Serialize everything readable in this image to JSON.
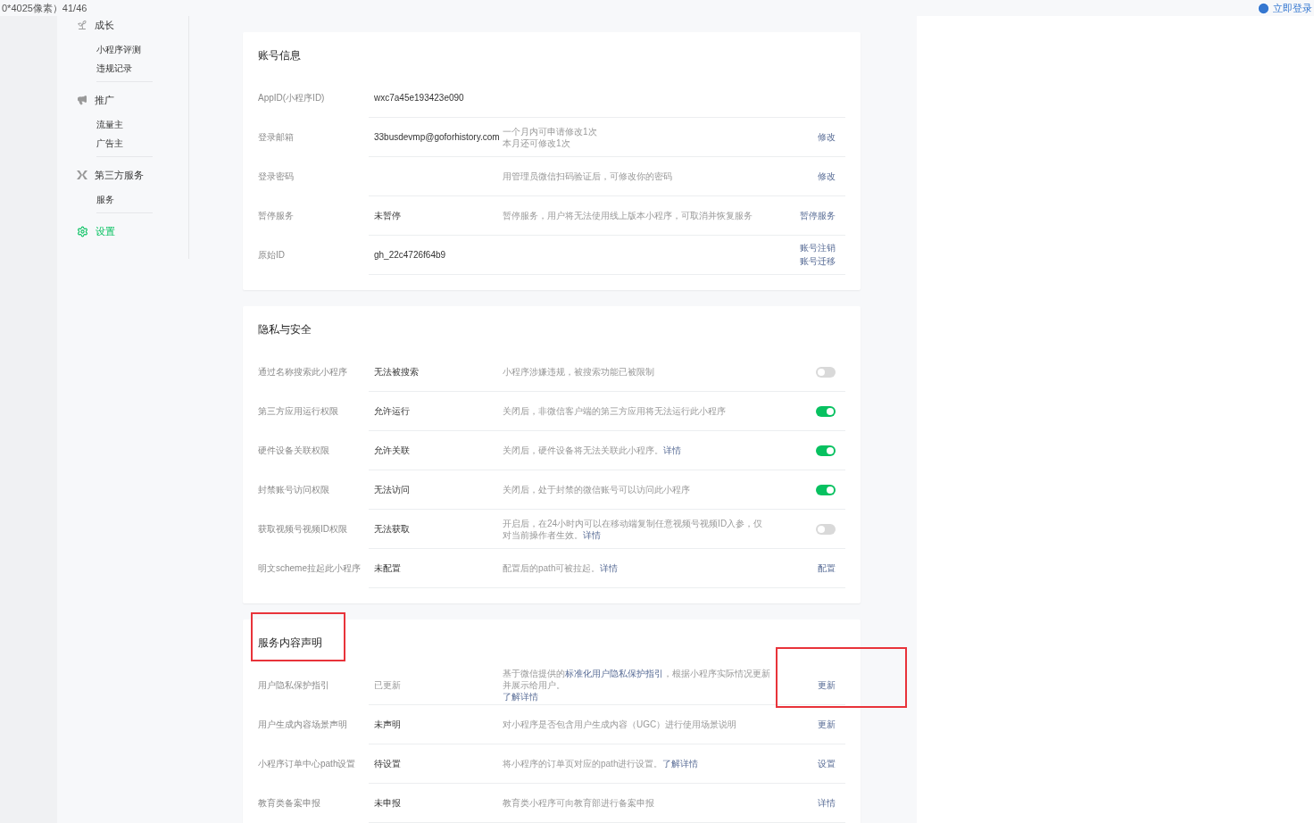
{
  "top_bar": {
    "caption": "0*4025像素）41/46",
    "login": "立即登录"
  },
  "sidebar": {
    "groups": [
      {
        "title": "成长",
        "kind": "growth",
        "selected": false,
        "items": [
          {
            "label": "小程序评测",
            "selected": false
          },
          {
            "label": "违规记录",
            "selected": false
          }
        ]
      },
      {
        "title": "推广",
        "kind": "promotion",
        "selected": false,
        "items": [
          {
            "label": "流量主",
            "selected": false
          },
          {
            "label": "广告主",
            "selected": false
          }
        ]
      },
      {
        "title": "第三方服务",
        "kind": "third-party",
        "selected": false,
        "items": [
          {
            "label": "服务",
            "selected": false
          }
        ]
      },
      {
        "title": "设置",
        "kind": "settings",
        "selected": true
      }
    ]
  },
  "sections": [
    {
      "title": "账号信息",
      "rows": [
        {
          "label": "AppID(小程序ID)",
          "value": "wxc7a45e193423e090"
        },
        {
          "label": "登录邮箱",
          "value": "33busdevmp@goforhistory.com",
          "description": [
            [
              {
                "text": "一个月内可申请修改1次",
                "link": false
              }
            ],
            [
              {
                "text": "本月还可修改1次",
                "link": false
              }
            ]
          ],
          "actions": [
            {
              "kind": "link",
              "text": "修改"
            }
          ]
        },
        {
          "label": "登录密码",
          "description": [
            [
              {
                "text": "用管理员微信扫码验证后，可修改你的密码",
                "link": false
              }
            ]
          ],
          "actions": [
            {
              "kind": "link",
              "text": "修改"
            }
          ]
        },
        {
          "label": "暂停服务",
          "value": "未暂停",
          "description": [
            [
              {
                "text": "暂停服务，用户将无法使用线上版本小程序，可取消并恢复服务",
                "link": false
              }
            ]
          ],
          "actions": [
            {
              "kind": "link",
              "text": "暂停服务"
            }
          ]
        },
        {
          "label": "原始ID",
          "value": "gh_22c4726f64b9",
          "actions": [
            {
              "kind": "link",
              "text": "账号注销"
            },
            {
              "kind": "link",
              "text": "账号迁移"
            }
          ]
        }
      ]
    },
    {
      "title": "隐私与安全",
      "rows": [
        {
          "label": "通过名称搜索此小程序",
          "value": "无法被搜索",
          "description": [
            [
              {
                "text": "小程序涉嫌违规，被搜索功能已被限制",
                "link": false
              }
            ]
          ],
          "actions": [
            {
              "kind": "toggle",
              "on": false
            }
          ]
        },
        {
          "label": "第三方应用运行权限",
          "value": "允许运行",
          "description": [
            [
              {
                "text": "关闭后，非微信客户端的第三方应用将无法运行此小程序",
                "link": false
              }
            ]
          ],
          "actions": [
            {
              "kind": "toggle",
              "on": true
            }
          ]
        },
        {
          "label": "硬件设备关联权限",
          "value": "允许关联",
          "description": [
            [
              {
                "text": "关闭后，硬件设备将无法关联此小程序。",
                "link": false
              },
              {
                "text": "详情",
                "link": true
              }
            ]
          ],
          "actions": [
            {
              "kind": "toggle",
              "on": true
            }
          ]
        },
        {
          "label": "封禁账号访问权限",
          "value": "无法访问",
          "description": [
            [
              {
                "text": "关闭后，处于封禁的微信账号可以访问此小程序",
                "link": false
              }
            ]
          ],
          "actions": [
            {
              "kind": "toggle",
              "on": true
            }
          ]
        },
        {
          "label": "获取视频号视频ID权限",
          "value": "无法获取",
          "description": [
            [
              {
                "text": "开启后，在24小时内可以在移动端复制任意视频号视频ID入参，仅对当前操作者生效。",
                "link": false
              },
              {
                "text": "详情",
                "link": true
              }
            ]
          ],
          "actions": [
            {
              "kind": "toggle",
              "on": false
            }
          ]
        },
        {
          "label": "明文scheme拉起此小程序",
          "value": "未配置",
          "description": [
            [
              {
                "text": "配置后的path可被拉起。",
                "link": false
              },
              {
                "text": "详情",
                "link": true
              }
            ]
          ],
          "actions": [
            {
              "kind": "link",
              "text": "配置"
            }
          ]
        }
      ]
    },
    {
      "title": "服务内容声明",
      "highlighted": true,
      "rows": [
        {
          "label": "用户隐私保护指引",
          "value": "已更新",
          "muted": true,
          "highlighted": true,
          "description": [
            [
              {
                "text": "基于微信提供的",
                "link": false
              },
              {
                "text": "标准化用户隐私保护指引",
                "link": true
              },
              {
                "text": "，根据小程序实际情况更新并展示给用户。",
                "link": false
              }
            ],
            [
              {
                "text": "了解详情",
                "link": true
              }
            ]
          ],
          "actions": [
            {
              "kind": "link",
              "text": "更新"
            }
          ]
        },
        {
          "label": "用户生成内容场景声明",
          "value": "未声明",
          "muted": false,
          "description": [
            [
              {
                "text": "对小程序是否包含用户生成内容（UGC）进行使用场景说明",
                "link": false
              }
            ]
          ],
          "actions": [
            {
              "kind": "link",
              "text": "更新"
            }
          ]
        },
        {
          "label": "小程序订单中心path设置",
          "value": "待设置",
          "muted": false,
          "description": [
            [
              {
                "text": "将小程序的订单页对应的path进行设置。",
                "link": false
              },
              {
                "text": "了解详情",
                "link": true
              }
            ]
          ],
          "actions": [
            {
              "kind": "link",
              "text": "设置"
            }
          ]
        },
        {
          "label": "教育类备案申报",
          "value": "未申报",
          "muted": false,
          "description": [
            [
              {
                "text": "教育类小程序可向教育部进行备案申报",
                "link": false
              }
            ]
          ],
          "actions": [
            {
              "kind": "link",
              "text": "详情"
            }
          ]
        }
      ]
    }
  ]
}
